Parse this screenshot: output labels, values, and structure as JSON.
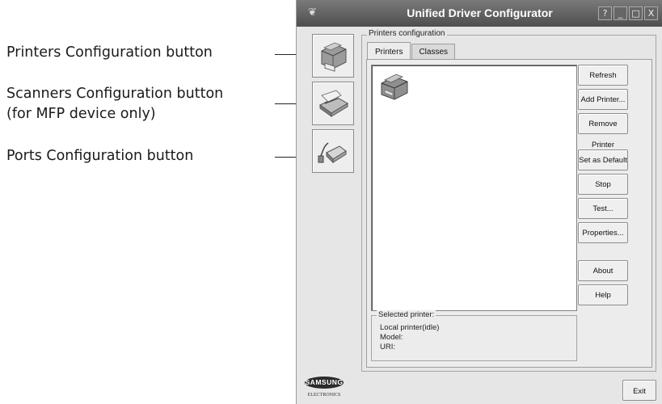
{
  "annotations": {
    "printers_config": "Printers Configuration button",
    "scanners_config_line1": "Scanners Configuration button",
    "scanners_config_line2": "(for MFP device only)",
    "ports_config": "Ports Configuration button"
  },
  "window": {
    "title": "Unified Driver Configurator",
    "controls": [
      "?",
      "_",
      "□",
      "X"
    ]
  },
  "sidebar": {
    "items": [
      {
        "name": "printers-config-button",
        "icon": "printer-icon"
      },
      {
        "name": "scanners-config-button",
        "icon": "scanner-icon"
      },
      {
        "name": "ports-config-button",
        "icon": "port-icon"
      }
    ]
  },
  "printers_config": {
    "group_title": "Printers configuration",
    "tabs": [
      "Printers",
      "Classes"
    ],
    "active_tab": "Printers",
    "actions": {
      "refresh": "Refresh",
      "add_printer": "Add Printer...",
      "remove_printer": "Remove Printer",
      "set_default": "Set as Default",
      "stop": "Stop",
      "test": "Test...",
      "properties": "Properties...",
      "about": "About",
      "help": "Help"
    },
    "selected_printer": {
      "title": "Selected printer:",
      "status": "Local printer(idle)",
      "model": "Model:",
      "uri": "URI:"
    }
  },
  "branding": {
    "logo": "SAMSUNG",
    "sub": "ELECTRONICS"
  },
  "footer": {
    "exit": "Exit"
  }
}
